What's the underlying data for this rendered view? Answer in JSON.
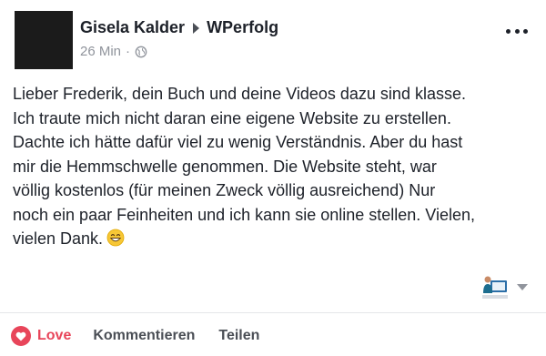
{
  "post": {
    "author": "Gisela Kalder",
    "target_page": "WPerfolg",
    "timestamp": "26 Min",
    "separator": "·",
    "privacy_icon": "globe-icon",
    "more_icon": "more-options-icon",
    "text": "Lieber Frederik, dein Buch und deine Videos dazu sind klasse.\nIch traute mich nicht daran eine eigene Website zu erstellen.\nDachte ich hätte dafür viel zu wenig Verständnis. Aber du hast\nmir die Hemmschwelle genommen. Die Website steht, war\nvöllig kostenlos (für meinen Zweck völlig ausreichend) Nur\nnoch ein paar Feinheiten und ich kann sie online stellen. Vielen,\nvielen Dank.",
    "emoji": "grinning-face-emoji"
  },
  "actions": {
    "love_label": "Love",
    "comment_label": "Kommentieren",
    "share_label": "Teilen"
  },
  "colors": {
    "love": "#e8455a",
    "text": "#1d2129",
    "muted": "#90949c"
  }
}
